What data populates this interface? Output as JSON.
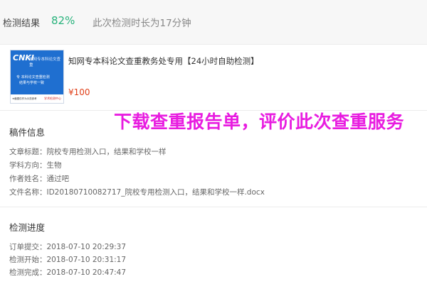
{
  "header": {
    "result_label": "检测结果",
    "result_percent": "82%",
    "duration_text": "此次检测时长为17分钟"
  },
  "product": {
    "thumbnail": {
      "brand": "CNKI",
      "brand_sub": "知网专本科论文查重",
      "line1": "专 本科论文查重检测",
      "line2": "结果与学校一致",
      "footer_left": "★截图仅作为示范参考",
      "footer_right": "学术检测中心"
    },
    "title": "知网专本科论文查重教务处专用【24小时自助检测】",
    "price": "¥100"
  },
  "overlay_text": "下载查重报告单，评价此次查重服务",
  "manuscript": {
    "section_title": "稿件信息",
    "rows": [
      {
        "key": "文章标题：",
        "value": "院校专用检测入口，结果和学校一样"
      },
      {
        "key": "学科方向：",
        "value": "生物"
      },
      {
        "key": "作者姓名：",
        "value": "通过吧"
      },
      {
        "key": "文件名称：",
        "value": "ID20180710082717_院校专用检测入口，结果和学校一样.docx"
      }
    ]
  },
  "progress": {
    "section_title": "检测进度",
    "rows": [
      {
        "key": "订单提交：",
        "value": "2018-07-10 20:29:37"
      },
      {
        "key": "检测开始：",
        "value": "2018-07-10 20:31:17"
      },
      {
        "key": "检测完成：",
        "value": "2018-07-10 20:47:47"
      }
    ]
  }
}
